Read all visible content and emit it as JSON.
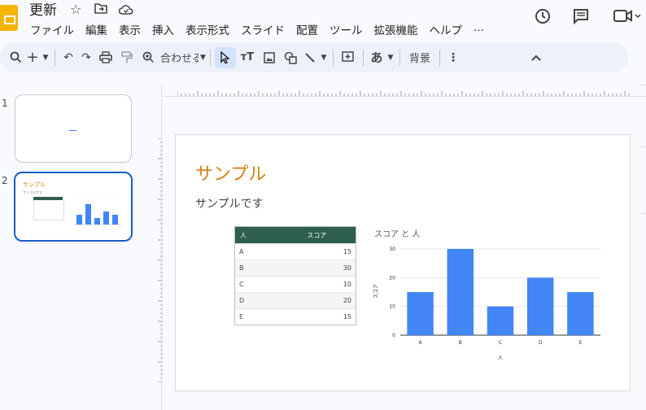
{
  "app": {
    "doc_title": "更新",
    "menu": [
      "ファイル",
      "編集",
      "表示",
      "挿入",
      "表示形式",
      "スライド",
      "配置",
      "ツール",
      "拡張機能",
      "ヘルプ",
      "..."
    ]
  },
  "toolbar": {
    "zoom_label": "合わせる",
    "background_label": "背景",
    "text_style_label": "あ"
  },
  "slides": {
    "numbers": [
      "1",
      "2"
    ]
  },
  "slide": {
    "title": "サンプル",
    "subtitle": "サンプルです",
    "table": {
      "headers": [
        "人",
        "スコア"
      ],
      "rows": [
        [
          "A",
          "15"
        ],
        [
          "B",
          "30"
        ],
        [
          "C",
          "10"
        ],
        [
          "D",
          "20"
        ],
        [
          "E",
          "15"
        ]
      ]
    },
    "chart_data": {
      "type": "bar",
      "title": "スコア と 人",
      "xlabel": "人",
      "ylabel": "スコア",
      "categories": [
        "A",
        "B",
        "C",
        "D",
        "E"
      ],
      "values": [
        15,
        30,
        10,
        20,
        15
      ],
      "ylim": [
        0,
        30
      ],
      "yticks": [
        0,
        10,
        20,
        30
      ],
      "grid": true,
      "color": "#4285f4"
    }
  },
  "thumb2": {
    "title": "サンプル",
    "subtitle": "サンプルです"
  },
  "colors": {
    "accent": "#1a5cc9",
    "title_orange": "#d48014",
    "table_header": "#2e5e4e",
    "bar": "#4285f4"
  }
}
